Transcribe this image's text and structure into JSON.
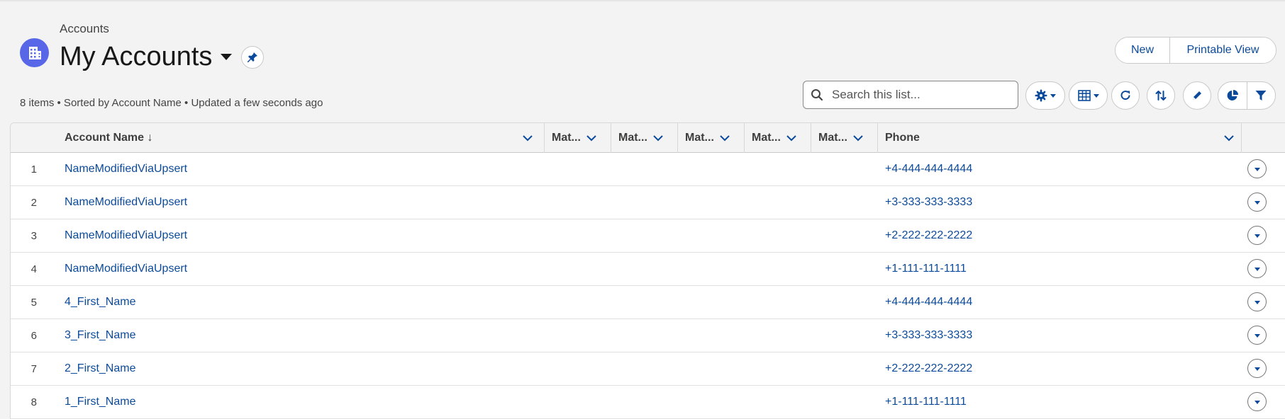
{
  "header": {
    "breadcrumb": "Accounts",
    "title": "My Accounts",
    "status": "8 items • Sorted by Account Name • Updated a few seconds ago"
  },
  "actions": {
    "new_label": "New",
    "printable_label": "Printable View"
  },
  "search": {
    "placeholder": "Search this list..."
  },
  "columns": {
    "account_name": "Account Name ↓",
    "mat": [
      "Mat...",
      "Mat...",
      "Mat...",
      "Mat...",
      "Mat..."
    ],
    "phone": "Phone"
  },
  "rows": [
    {
      "num": "1",
      "name": "NameModifiedViaUpsert",
      "phone": "+4-444-444-4444"
    },
    {
      "num": "2",
      "name": "NameModifiedViaUpsert",
      "phone": "+3-333-333-3333"
    },
    {
      "num": "3",
      "name": "NameModifiedViaUpsert",
      "phone": "+2-222-222-2222"
    },
    {
      "num": "4",
      "name": "NameModifiedViaUpsert",
      "phone": "+1-111-111-1111"
    },
    {
      "num": "5",
      "name": "4_First_Name",
      "phone": "+4-444-444-4444"
    },
    {
      "num": "6",
      "name": "3_First_Name",
      "phone": "+3-333-333-3333"
    },
    {
      "num": "7",
      "name": "2_First_Name",
      "phone": "+2-222-222-2222"
    },
    {
      "num": "8",
      "name": "1_First_Name",
      "phone": "+1-111-111-1111"
    }
  ],
  "icons": {
    "object": "building-icon",
    "pin": "pin-icon",
    "search": "search-icon",
    "settings": "gear-icon",
    "display": "table-icon",
    "refresh": "refresh-icon",
    "sort": "sort-icon",
    "edit": "pencil-icon",
    "chart": "pie-chart-icon",
    "filter": "filter-icon",
    "row_action": "chevron-down-icon"
  },
  "colors": {
    "brand": "#5867e8",
    "link": "#0b4a9a"
  }
}
